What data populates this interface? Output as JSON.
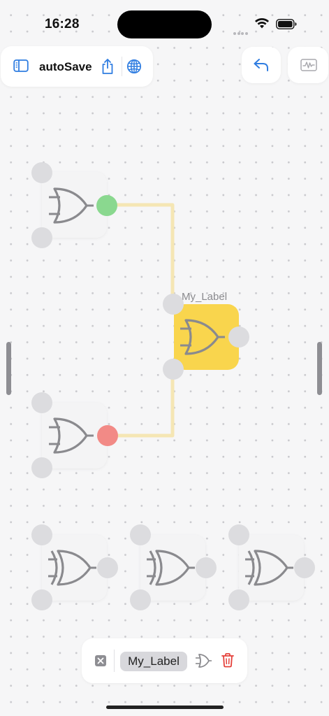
{
  "status_bar": {
    "time": "16:28"
  },
  "toolbar": {
    "title": "autoSave",
    "icons": [
      "sidebar-icon",
      "share-icon",
      "globe-icon"
    ]
  },
  "top_right": {
    "icons": [
      "undo-icon",
      "waveform-icon"
    ]
  },
  "canvas": {
    "colors": {
      "wire": "#f5e6b4",
      "active_output": "#8ad88f",
      "inactive_output": "#f28a86",
      "selected_gate": "#f9d54d",
      "gate_card": "#f4f4f5",
      "port": "#dcdcdf",
      "symbol": "#8a8a8e"
    },
    "selected_label": "My_Label",
    "gates": [
      {
        "id": "g1",
        "type": "OR",
        "selected": false,
        "output_state": "high"
      },
      {
        "id": "g2",
        "type": "OR",
        "selected": true,
        "label": "My_Label",
        "output_state": "none"
      },
      {
        "id": "g3",
        "type": "OR",
        "selected": false,
        "output_state": "low"
      },
      {
        "id": "g4",
        "type": "XOR",
        "selected": false,
        "output_state": "none"
      },
      {
        "id": "g5",
        "type": "XOR",
        "selected": false,
        "output_state": "none"
      },
      {
        "id": "g6",
        "type": "XOR",
        "selected": false,
        "output_state": "none"
      }
    ],
    "wires": [
      {
        "from": "g1",
        "to": "g2",
        "to_input": 1
      },
      {
        "from": "g3",
        "to": "g2",
        "to_input": 2
      }
    ]
  },
  "bottom_bar": {
    "chip_label": "My_Label",
    "icons": [
      "close-icon",
      "or-gate-icon",
      "trash-icon"
    ],
    "trash_color": "#e5403a"
  }
}
